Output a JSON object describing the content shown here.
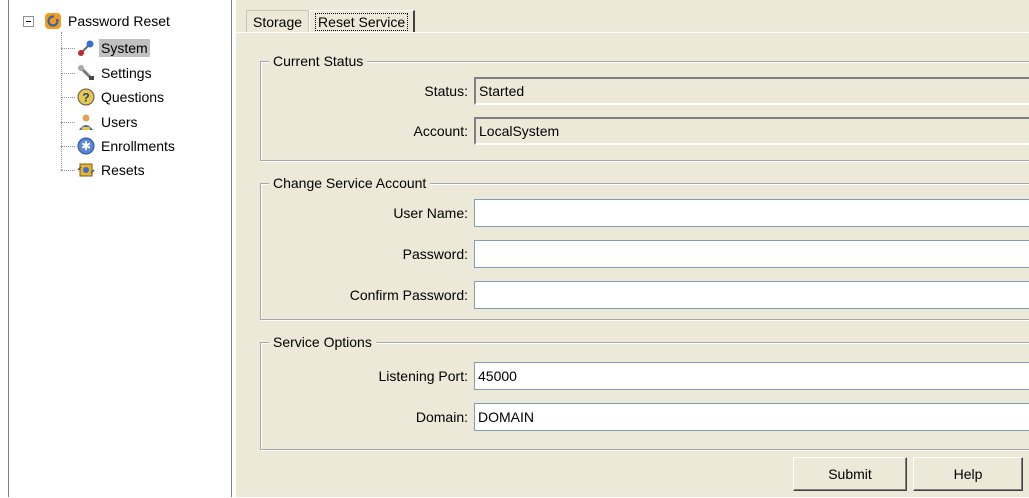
{
  "tree": {
    "root_label": "Password Reset",
    "items": [
      {
        "label": "System",
        "icon": "system-icon"
      },
      {
        "label": "Settings",
        "icon": "wrench-icon"
      },
      {
        "label": "Questions",
        "icon": "question-icon"
      },
      {
        "label": "Users",
        "icon": "user-icon"
      },
      {
        "label": "Enrollments",
        "icon": "enrollment-icon"
      },
      {
        "label": "Resets",
        "icon": "resets-icon"
      }
    ],
    "selected": "System"
  },
  "tabs": [
    {
      "label": "Storage",
      "active": false
    },
    {
      "label": "Reset Service",
      "active": true
    }
  ],
  "current_status": {
    "title": "Current Status",
    "status_label": "Status:",
    "status_value": "Started",
    "account_label": "Account:",
    "account_value": "LocalSystem"
  },
  "change_account": {
    "title": "Change Service Account",
    "username_label": "User Name:",
    "username_value": "",
    "password_label": "Password:",
    "password_value": "",
    "confirm_label": "Confirm Password:",
    "confirm_value": ""
  },
  "service_options": {
    "title": "Service Options",
    "port_label": "Listening Port:",
    "port_value": "45000",
    "domain_label": "Domain:",
    "domain_value": "DOMAIN"
  },
  "buttons": {
    "submit": "Submit",
    "help": "Help"
  }
}
